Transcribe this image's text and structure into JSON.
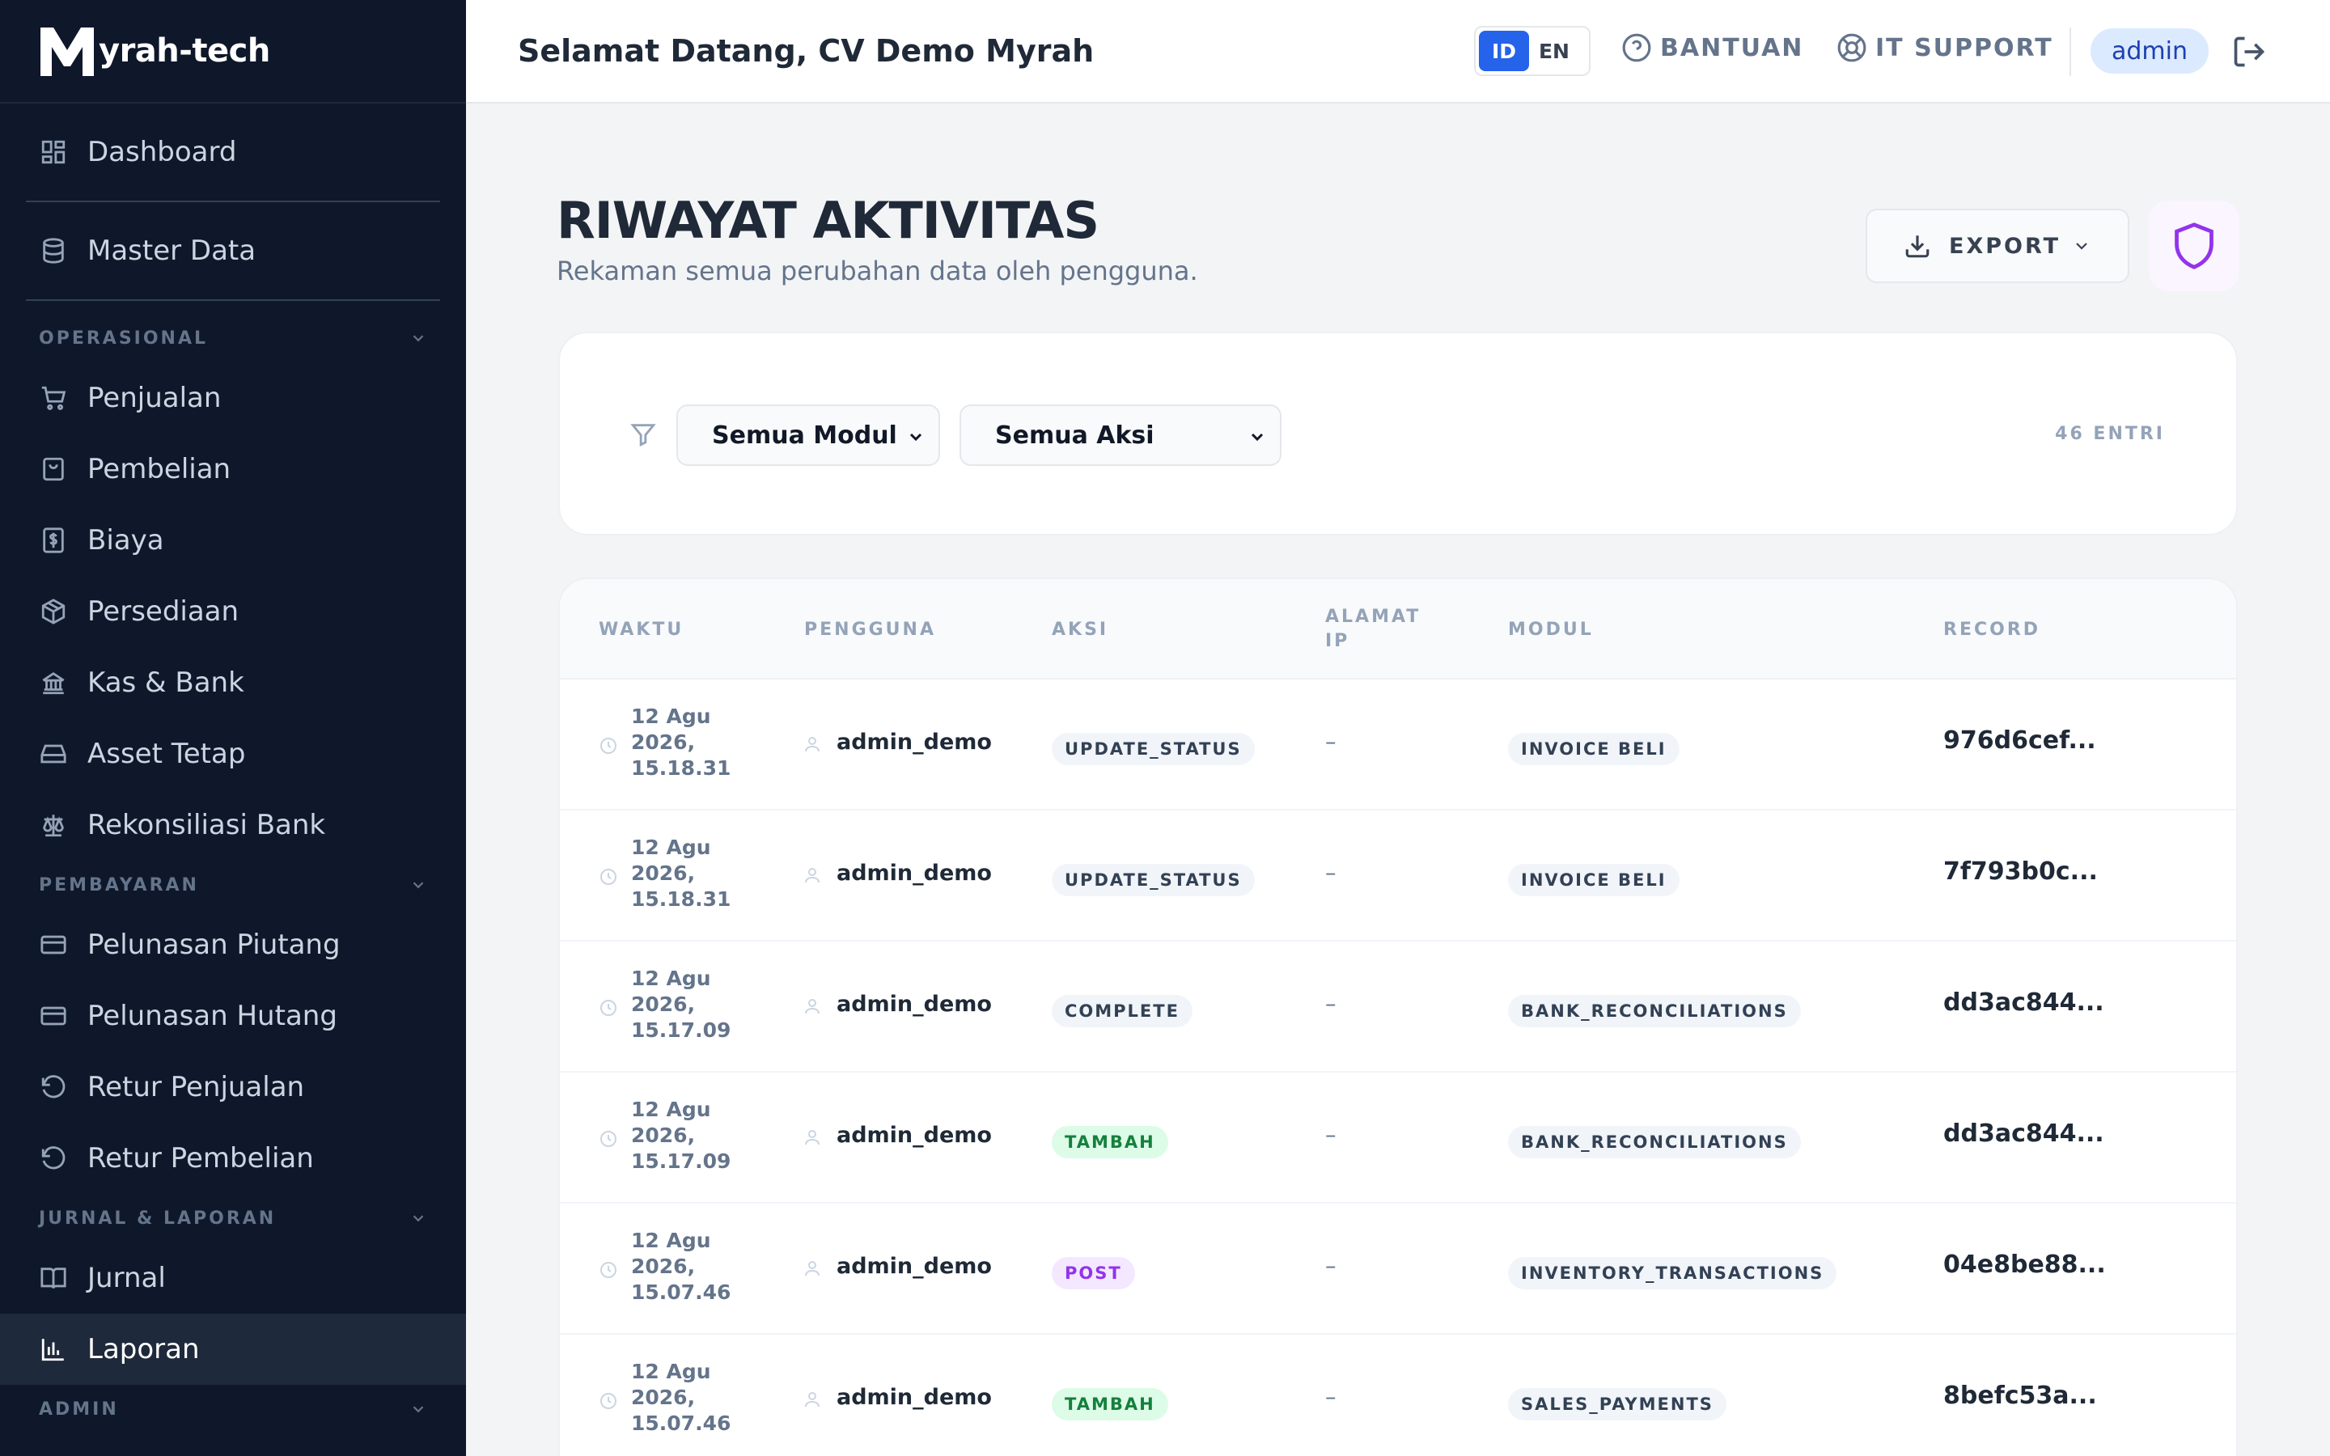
{
  "brand": {
    "logo_letter": "M",
    "name": "yrah-tech"
  },
  "sidebar": {
    "dashboard": "Dashboard",
    "master": "Master Data",
    "sections": [
      {
        "title": "OPERASIONAL",
        "items": [
          "Penjualan",
          "Pembelian",
          "Biaya",
          "Persediaan",
          "Kas & Bank",
          "Asset Tetap",
          "Rekonsiliasi Bank"
        ]
      },
      {
        "title": "PEMBAYARAN",
        "items": [
          "Pelunasan Piutang",
          "Pelunasan Hutang",
          "Retur Penjualan",
          "Retur Pembelian"
        ]
      },
      {
        "title": "JURNAL & LAPORAN",
        "items": [
          "Jurnal",
          "Laporan"
        ]
      },
      {
        "title": "ADMIN",
        "items": []
      }
    ],
    "active": "Laporan"
  },
  "header": {
    "greeting": "Selamat Datang, CV Demo Myrah",
    "lang_id": "ID",
    "lang_en": "EN",
    "help": "BANTUAN",
    "support": "IT SUPPORT",
    "user": "admin"
  },
  "page": {
    "title": "RIWAYAT AKTIVITAS",
    "subtitle": "Rekaman semua perubahan data oleh pengguna.",
    "export": "EXPORT"
  },
  "filters": {
    "module": "Semua Modul",
    "action": "Semua Aksi",
    "count": "46 ENTRI"
  },
  "table": {
    "headers": [
      "WAKTU",
      "PENGGUNA",
      "AKSI",
      "ALAMAT IP",
      "MODUL",
      "RECORD"
    ],
    "rows": [
      {
        "time": [
          "12 Agu",
          "2026,",
          "15.18.31"
        ],
        "user": "admin_demo",
        "action": "UPDATE_STATUS",
        "action_style": "gray",
        "ip": "–",
        "module": "INVOICE BELI",
        "record": "976d6cef..."
      },
      {
        "time": [
          "12 Agu",
          "2026,",
          "15.18.31"
        ],
        "user": "admin_demo",
        "action": "UPDATE_STATUS",
        "action_style": "gray",
        "ip": "–",
        "module": "INVOICE BELI",
        "record": "7f793b0c..."
      },
      {
        "time": [
          "12 Agu",
          "2026,",
          "15.17.09"
        ],
        "user": "admin_demo",
        "action": "COMPLETE",
        "action_style": "gray",
        "ip": "–",
        "module": "BANK_RECONCILIATIONS",
        "record": "dd3ac844..."
      },
      {
        "time": [
          "12 Agu",
          "2026,",
          "15.17.09"
        ],
        "user": "admin_demo",
        "action": "TAMBAH",
        "action_style": "green",
        "ip": "–",
        "module": "BANK_RECONCILIATIONS",
        "record": "dd3ac844..."
      },
      {
        "time": [
          "12 Agu",
          "2026,",
          "15.07.46"
        ],
        "user": "admin_demo",
        "action": "POST",
        "action_style": "purple",
        "ip": "–",
        "module": "INVENTORY_TRANSACTIONS",
        "record": "04e8be88..."
      },
      {
        "time": [
          "12 Agu",
          "2026,",
          "15.07.46"
        ],
        "user": "admin_demo",
        "action": "TAMBAH",
        "action_style": "green",
        "ip": "–",
        "module": "SALES_PAYMENTS",
        "record": "8befc53a..."
      }
    ]
  },
  "colors": {
    "sidebar_bg": "#0f172a",
    "accent": "#2563eb",
    "badge_gray_bg": "#f1f5f9",
    "badge_gray_fg": "#334155",
    "badge_green_bg": "#dcfce7",
    "badge_green_fg": "#15803d",
    "badge_purple_bg": "#f3e8ff",
    "badge_purple_fg": "#9333ea"
  }
}
